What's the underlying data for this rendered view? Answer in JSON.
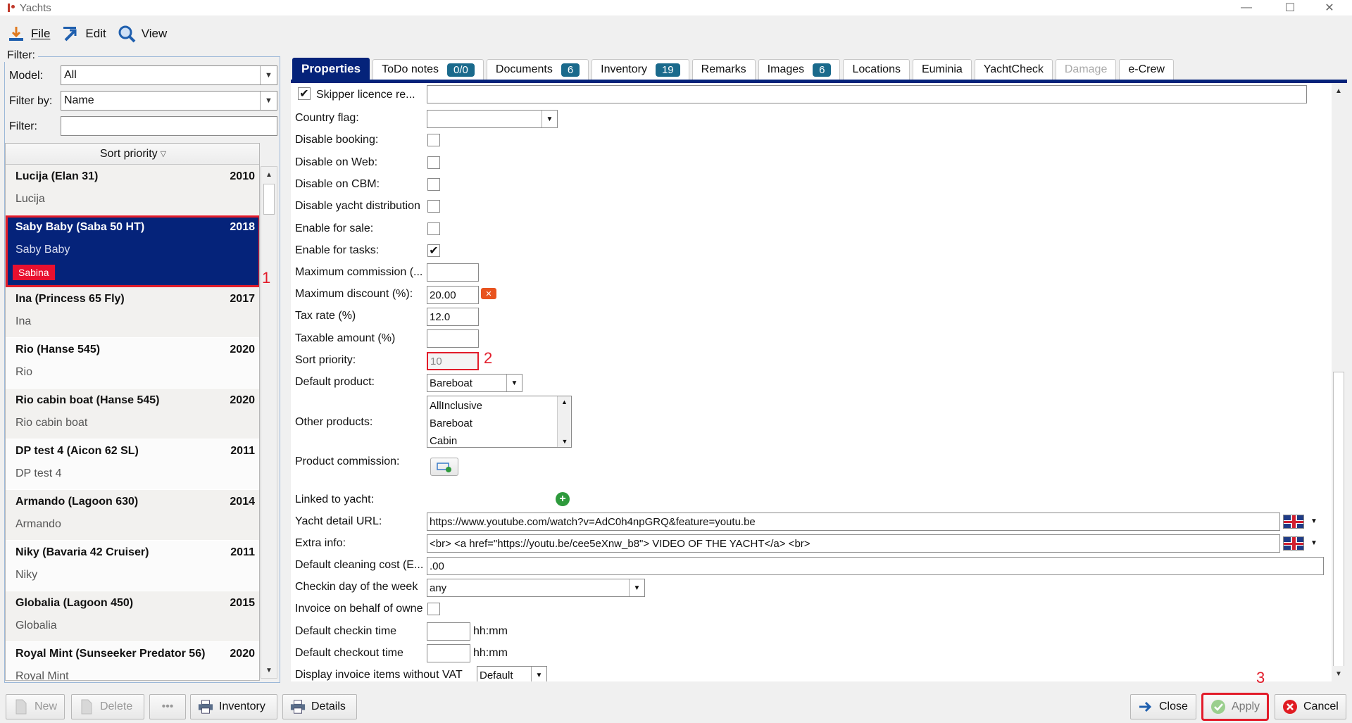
{
  "window": {
    "title": "Yachts",
    "minimize_glyph": "—",
    "maximize_glyph": "☐",
    "close_glyph": "✕"
  },
  "menu": {
    "file": "File",
    "edit": "Edit",
    "view": "View"
  },
  "filter": {
    "legend": "Filter:",
    "model_label": "Model:",
    "model_value": "All",
    "filter_by_label": "Filter by:",
    "filter_by_value": "Name",
    "filter_label": "Filter:",
    "filter_value": ""
  },
  "list": {
    "header": "Sort priority",
    "items": [
      {
        "name": "Lucija (Elan 31)",
        "year": "2010",
        "sub": "Lucija",
        "tag": ""
      },
      {
        "name": "Saby Baby (Saba 50 HT)",
        "year": "2018",
        "sub": "Saby Baby",
        "tag": "Sabina"
      },
      {
        "name": "Ina (Princess 65 Fly)",
        "year": "2017",
        "sub": "Ina",
        "tag": ""
      },
      {
        "name": "Rio (Hanse 545)",
        "year": "2020",
        "sub": "Rio",
        "tag": ""
      },
      {
        "name": "Rio cabin boat (Hanse 545)",
        "year": "2020",
        "sub": "Rio cabin boat",
        "tag": ""
      },
      {
        "name": "DP test 4 (Aicon 62 SL)",
        "year": "2011",
        "sub": "DP test 4",
        "tag": ""
      },
      {
        "name": "Armando (Lagoon 630)",
        "year": "2014",
        "sub": "Armando",
        "tag": ""
      },
      {
        "name": "Niky (Bavaria 42 Cruiser)",
        "year": "2011",
        "sub": "Niky",
        "tag": ""
      },
      {
        "name": "Globalia (Lagoon 450)",
        "year": "2015",
        "sub": "Globalia",
        "tag": ""
      },
      {
        "name": "Royal Mint (Sunseeker Predator 56)",
        "year": "2020",
        "sub": "Royal Mint",
        "tag": ""
      }
    ]
  },
  "annotations": {
    "one": "1",
    "two": "2",
    "three": "3"
  },
  "tabs": [
    {
      "label": "Properties",
      "count": "",
      "state": "active"
    },
    {
      "label": "ToDo notes",
      "count": "0/0",
      "state": "normal"
    },
    {
      "label": "Documents",
      "count": "6",
      "state": "normal"
    },
    {
      "label": "Inventory",
      "count": "19",
      "state": "normal"
    },
    {
      "label": "Remarks",
      "count": "",
      "state": "normal"
    },
    {
      "label": "Images",
      "count": "6",
      "state": "normal"
    },
    {
      "label": "Locations",
      "count": "",
      "state": "normal"
    },
    {
      "label": "Euminia",
      "count": "",
      "state": "normal"
    },
    {
      "label": "YachtCheck",
      "count": "",
      "state": "normal"
    },
    {
      "label": "Damage",
      "count": "",
      "state": "disabled"
    },
    {
      "label": "e-Crew",
      "count": "",
      "state": "normal"
    }
  ],
  "props": {
    "skipper_licence": "Skipper licence re...",
    "skipper_checked": "✔",
    "country_flag": "Country flag:",
    "disable_booking": "Disable booking:",
    "disable_web": "Disable on Web:",
    "disable_cbm": "Disable on CBM:",
    "disable_distribution": "Disable yacht distribution",
    "enable_sale": "Enable for sale:",
    "enable_tasks": "Enable for tasks:",
    "enable_tasks_checked": "✔",
    "max_commission": "Maximum commission (...",
    "max_discount": "Maximum discount (%):",
    "max_discount_value": "20.00",
    "tax_rate": "Tax rate (%)",
    "tax_rate_value": "12.0",
    "taxable_amount": "Taxable amount (%)",
    "sort_priority": "Sort priority:",
    "sort_priority_value": "10",
    "default_product": "Default product:",
    "default_product_value": "Bareboat",
    "other_products": "Other products:",
    "other_products_items": [
      "AllInclusive",
      "Bareboat",
      "Cabin"
    ],
    "product_commission": "Product commission:",
    "linked_to_yacht": "Linked to yacht:",
    "yacht_detail_url": "Yacht detail URL:",
    "yacht_detail_url_value": "https://www.youtube.com/watch?v=AdC0h4npGRQ&feature=youtu.be",
    "extra_info": "Extra info:",
    "extra_info_value": "<br> <a href=\"https://youtu.be/cee5eXnw_b8\"> VIDEO OF THE YACHT</a> <br>",
    "default_cleaning": "Default cleaning cost (E...",
    "default_cleaning_value": ".00",
    "checkin_day": "Checkin day of the week",
    "checkin_day_value": "any",
    "invoice_behalf": "Invoice on behalf of owne",
    "default_checkin_time": "Default checkin time",
    "default_checkout_time": "Default checkout time",
    "hhmm": "hh:mm",
    "display_invoice": "Display invoice items without VAT",
    "display_invoice_value": "Default"
  },
  "buttons": {
    "new": "New",
    "delete": "Delete",
    "more": "•••",
    "inventory": "Inventory",
    "details": "Details",
    "close": "Close",
    "apply": "Apply",
    "cancel": "Cancel"
  },
  "colors": {
    "selection": "#05237a",
    "highlight": "#e21c2a",
    "count_badge": "#1a6a8c"
  }
}
